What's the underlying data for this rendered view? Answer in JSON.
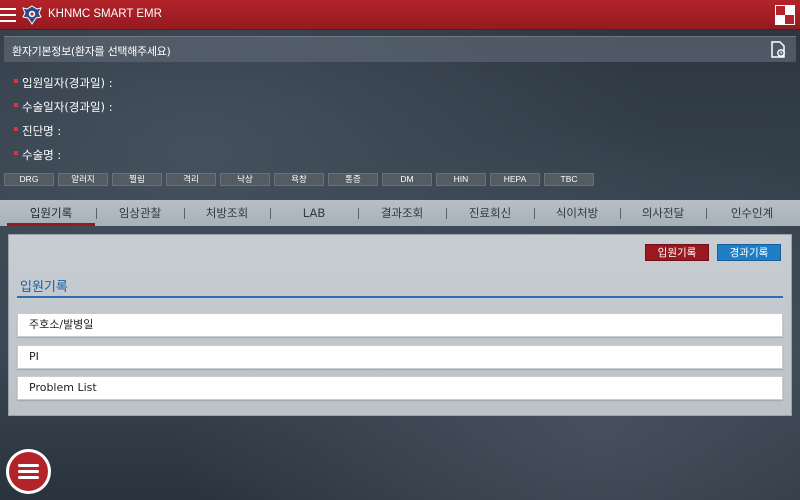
{
  "app": {
    "title": "KHNMC SMART EMR"
  },
  "patient_bar": {
    "label": "환자기본정보(환자를 선택해주세요)"
  },
  "info": [
    {
      "label": "입원일자(경과일) :"
    },
    {
      "label": "수술일자(경과일) :"
    },
    {
      "label": "진단명 :"
    },
    {
      "label": "수술명 :"
    }
  ],
  "tags": [
    "DRG",
    "알러지",
    "찔림",
    "격리",
    "낙상",
    "욕창",
    "통증",
    "DM",
    "HIN",
    "HEPA",
    "TBC"
  ],
  "tabs": [
    {
      "label": "입원기록",
      "active": true
    },
    {
      "label": "임상관찰"
    },
    {
      "label": "처방조회"
    },
    {
      "label": "LAB"
    },
    {
      "label": "결과조회"
    },
    {
      "label": "진료회신"
    },
    {
      "label": "식이처방"
    },
    {
      "label": "의사전달"
    },
    {
      "label": "인수인계"
    }
  ],
  "panel": {
    "btn_admission": "입원기록",
    "btn_progress": "경과기록",
    "title": "입원기록",
    "items": [
      {
        "label": "주호소/발병일"
      },
      {
        "label": "PI"
      },
      {
        "label": "Problem List"
      }
    ]
  },
  "colors": {
    "brand_red": "#b3232a",
    "accent_blue": "#1e7fc7",
    "title_blue": "#1f5ea0"
  }
}
